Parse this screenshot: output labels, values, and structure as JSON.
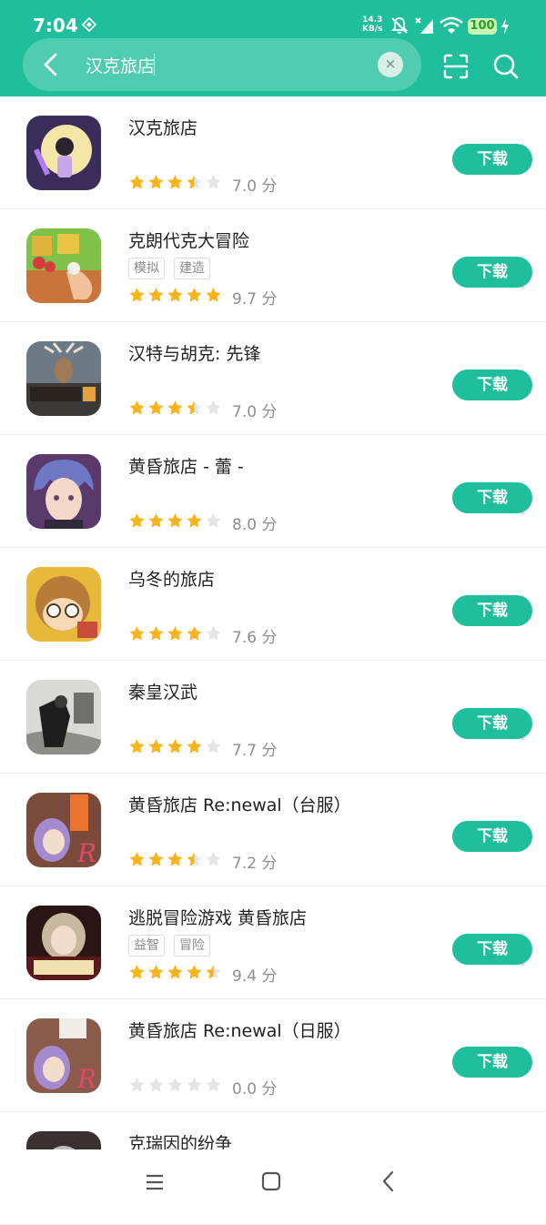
{
  "status_bar": {
    "time": "7:04",
    "net_speed_value": "14.3",
    "net_speed_unit": "KB/s",
    "battery": "100"
  },
  "search": {
    "query": "汉克旅店",
    "clear_symbol": "×"
  },
  "colors": {
    "accent": "#1fbe9c",
    "star_on": "#f9b31d",
    "star_off": "#e5e5e5"
  },
  "download_label": "下载",
  "score_unit": "分",
  "apps": [
    {
      "name": "汉克旅店",
      "tags": [],
      "rating": 3.5,
      "score": "7.0"
    },
    {
      "name": "克朗代克大冒险",
      "tags": [
        "模拟",
        "建造"
      ],
      "rating": 5,
      "score": "9.7"
    },
    {
      "name": "汉特与胡克: 先锋",
      "tags": [],
      "rating": 3.5,
      "score": "7.0"
    },
    {
      "name": "黄昏旅店 - 蕾 -",
      "tags": [],
      "rating": 4,
      "score": "8.0"
    },
    {
      "name": "乌冬的旅店",
      "tags": [],
      "rating": 4,
      "score": "7.6"
    },
    {
      "name": "秦皇汉武",
      "tags": [],
      "rating": 4,
      "score": "7.7"
    },
    {
      "name": "黄昏旅店 Re:newal（台服）",
      "tags": [],
      "rating": 3.5,
      "score": "7.2"
    },
    {
      "name": "逃脱冒险游戏 黄昏旅店",
      "tags": [
        "益智",
        "冒险"
      ],
      "rating": 4.5,
      "score": "9.4"
    },
    {
      "name": "黄昏旅店 Re:newal（日服）",
      "tags": [],
      "rating": 0,
      "score": "0.0"
    },
    {
      "name": "克瑞因的纷争",
      "tags": [],
      "rating": 0,
      "score": ""
    }
  ]
}
